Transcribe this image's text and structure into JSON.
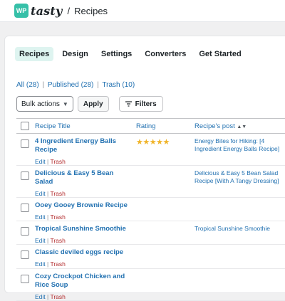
{
  "header": {
    "logo_badge": "WP",
    "logo_text": "tasty",
    "breadcrumb_sep": "/",
    "breadcrumb_page": "Recipes"
  },
  "tabs": [
    {
      "label": "Recipes",
      "active": true
    },
    {
      "label": "Design",
      "active": false
    },
    {
      "label": "Settings",
      "active": false
    },
    {
      "label": "Converters",
      "active": false
    },
    {
      "label": "Get Started",
      "active": false
    }
  ],
  "views": {
    "all": "All",
    "all_count": "(28)",
    "published": "Published",
    "published_count": "(28)",
    "trash": "Trash",
    "trash_count": "(10)",
    "sep": "|"
  },
  "actions": {
    "bulk_actions": "Bulk actions",
    "apply": "Apply",
    "filters": "Filters"
  },
  "table": {
    "col_title": "Recipe Title",
    "col_rating": "Rating",
    "col_post": "Recipe's post",
    "row_edit": "Edit",
    "row_sep": "|",
    "row_trash": "Trash",
    "rows": [
      {
        "title": "4 Ingredient Energy Balls Recipe",
        "rating": "★★★★★",
        "post": "Energy Bites for Hiking: [4 Ingredient Energy Balls Recipe]"
      },
      {
        "title": "Delicious & Easy 5 Bean Salad",
        "rating": "",
        "post": "Delicious & Easy 5 Bean Salad Recipe [With A Tangy Dressing]"
      },
      {
        "title": "Ooey Gooey Brownie Recipe",
        "rating": "",
        "post": ""
      },
      {
        "title": "Tropical Sunshine Smoothie",
        "rating": "",
        "post": "Tropical Sunshine Smoothie"
      },
      {
        "title": "Classic deviled eggs recipe",
        "rating": "",
        "post": ""
      },
      {
        "title": "Cozy Crockpot Chicken and Rice Soup",
        "rating": "",
        "post": ""
      }
    ]
  },
  "colors": {
    "accent": "#36c0a8",
    "link": "#2271b1",
    "trash": "#b32d2e",
    "active_tab_bg": "#def4f0",
    "star": "#f0b429"
  }
}
